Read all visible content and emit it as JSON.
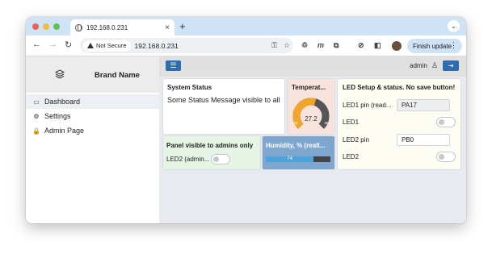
{
  "browser": {
    "tab_title": "192.168.0.231",
    "tab_close": "×",
    "new_tab": "+",
    "tab_search": "⌄",
    "security_label": "Not Secure",
    "url": "192.168.0.231",
    "finish_update_label": "Finish update",
    "more_menu": "⋮",
    "back": "←",
    "forward": "→",
    "reload": "↻"
  },
  "sidebar": {
    "brand_name": "Brand Name",
    "items": [
      {
        "label": "Dashboard",
        "icon": "monitor-icon",
        "glyph": "▭",
        "active": true
      },
      {
        "label": "Settings",
        "icon": "gear-icon",
        "glyph": "⚙",
        "active": false
      },
      {
        "label": "Admin Page",
        "icon": "lock-icon",
        "glyph": "🔒",
        "active": false
      }
    ]
  },
  "topbar": {
    "menu_glyph": "☰",
    "user_label": "admin",
    "user_glyph": "♙",
    "logout_glyph": "⇥"
  },
  "cards": {
    "system_status": {
      "title": "System Status",
      "message": "Some Status Message visible to all"
    },
    "temperature": {
      "title": "Temperat...",
      "value": 27.2,
      "display_value": "27.2",
      "min_label": "16",
      "max_label": "36",
      "min": 16,
      "max": 36
    },
    "admin_panel": {
      "title": "Panel visible to admins only",
      "led2_label": "LED2 (admin...",
      "led2_on": false
    },
    "humidity": {
      "title": "Humidity, % (realt...",
      "value": 74,
      "display_value": "74"
    },
    "led_setup": {
      "title": "LED Setup & status. No save button!",
      "led1_pin_label": "LED1 pin (read...",
      "led1_pin_value": "PA17",
      "led1_label": "LED1",
      "led1_on": false,
      "led2_pin_label": "LED2 pin",
      "led2_pin_value": "PB0",
      "led2_label": "LED2",
      "led2_on": false
    }
  },
  "colors": {
    "accent": "#2c6db2",
    "gauge_fill": "#f0a62a",
    "gauge_rest": "#555555",
    "humidity_fill": "#4da3dc"
  }
}
